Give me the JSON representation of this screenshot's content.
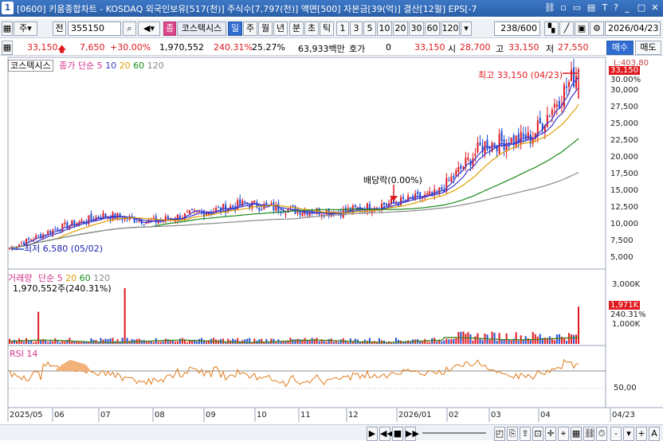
{
  "window": {
    "number": "1",
    "title": "[0600] 키움종합차트 - KOSDAQ 외국인보유[517(천)] 주식수[7,797(천)] 액면[500] 자본금[39(억)] 결산[12월] EPS[-7"
  },
  "toolbar": {
    "period_type": "주",
    "prev_label": "전",
    "code": "355150",
    "index_btn": "종",
    "index_name": "코스텍시스",
    "periods": [
      "일",
      "주",
      "월",
      "년",
      "분",
      "초",
      "틱"
    ],
    "minutes": [
      "1",
      "3",
      "5",
      "10",
      "20",
      "30",
      "60",
      "120"
    ],
    "count": "238/600",
    "date": "2026/04/23",
    "buy_label": "매수",
    "sell_label": "매도"
  },
  "quote": {
    "price": "33,150",
    "change": "7,650",
    "change_pct": "+30.00%",
    "volume": "1,970,552",
    "vol_ratio": "240.31%",
    "turnover": "25.27%",
    "amount": "63,933백만",
    "hoga_label": "호가",
    "hoga_value": "0",
    "hoga_price": "33,150",
    "open_label": "시",
    "open": "28,700",
    "high_label": "고",
    "high": "33,150",
    "low_label": "저",
    "low": "27,550"
  },
  "price_panel": {
    "name": "코스텍시스",
    "ma_label": "종가 단순",
    "ma_periods": [
      "5",
      "10",
      "20",
      "60",
      "120"
    ],
    "ma_colors": [
      "#3a3acc",
      "#3a3acc",
      "#e0a000",
      "#1a8a1a",
      "#888888"
    ],
    "high_annotation": "최고 33,150 (04/23)",
    "low_annotation": "최저 6,580 (05/02)",
    "dividend_annotation": "배당락(0.00%)",
    "top_axis": "L:403.80",
    "current_price": "33,150",
    "current_pct": "30.00%",
    "y_ticks": [
      "30,000",
      "27,500",
      "25,000",
      "22,500",
      "20,000",
      "17,500",
      "15,000",
      "12,500",
      "10,000",
      "7,500",
      "5,000"
    ]
  },
  "volume_panel": {
    "label": "거래량",
    "ma_label": "단순",
    "ma_periods": [
      "5",
      "20",
      "60",
      "120"
    ],
    "current": "1,970,552주(240.31%)",
    "y_ticks": [
      "3,000K",
      "1,000K"
    ],
    "current_box": "1,971K",
    "current_pct": "240.31%"
  },
  "rsi_panel": {
    "label": "RSI 14",
    "y_tick": "50,00"
  },
  "x_axis": [
    "2025/05",
    "06",
    "07",
    "08",
    "09",
    "10",
    "11",
    "12",
    "2026/01",
    "02",
    "03",
    "04",
    "04/23"
  ],
  "chart_data": {
    "type": "line",
    "title": "코스텍시스",
    "x": [
      "2025/05",
      "06",
      "07",
      "08",
      "09",
      "10",
      "11",
      "12",
      "2026/01",
      "02",
      "03",
      "04",
      "04/23"
    ],
    "series": [
      {
        "name": "종가",
        "values": [
          6580,
          9500,
          11500,
          10500,
          11800,
          13200,
          12200,
          12000,
          13200,
          14500,
          22000,
          23000,
          33150
        ]
      }
    ],
    "ylim": [
      5000,
      33150
    ]
  }
}
